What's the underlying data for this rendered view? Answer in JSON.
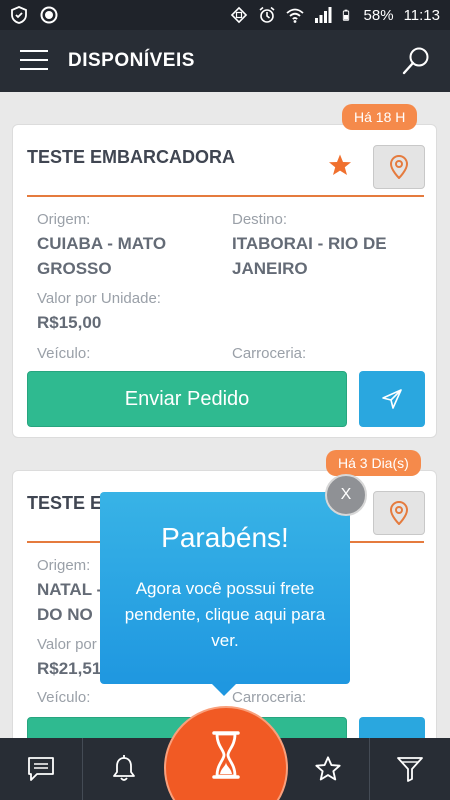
{
  "status_bar": {
    "battery": "58%",
    "time": "11:13",
    "icons": [
      "shield-icon",
      "record-icon",
      "rotate-icon",
      "alarm-icon",
      "wifi-icon",
      "signal-icon",
      "battery-icon"
    ]
  },
  "header": {
    "title": "DISPONÍVEIS",
    "icons": [
      "menu-icon",
      "search-icon"
    ]
  },
  "cards": [
    {
      "age": "Há 18 H",
      "company": "TESTE EMBARCADORA",
      "origin_label": "Origem:",
      "origin_line1": "CUIABA - MATO",
      "origin_line2": "GROSSO",
      "dest_label": "Destino:",
      "dest_line1": "ITABORAI - RIO DE",
      "dest_line2": "JANEIRO",
      "price_label": "Valor por Unidade:",
      "price": "R$15,00",
      "vehicle_label": "Veículo:",
      "body_label": "Carroceria:",
      "send_label": "Enviar Pedido"
    },
    {
      "age": "Há 3 Dia(s)",
      "company": "TESTE EM",
      "origin_label": "Origem:",
      "origin_line1": "NATAL -",
      "origin_line2": "DO NO",
      "price_label": "Valor por",
      "price": "R$21,51",
      "vehicle_label": "Veículo:",
      "body_label": "Carroceria:"
    }
  ],
  "popup": {
    "title": "Parabéns!",
    "body": "Agora você possui frete pendente, clique aqui para ver.",
    "close": "X"
  },
  "bottom_nav": {
    "icons": [
      "chat-icon",
      "bell-icon",
      "hourglass-icon",
      "star-icon",
      "filter-icon"
    ]
  },
  "colors": {
    "appbar": "#282d35",
    "accent_orange": "#f58a4b",
    "divider": "#e57b3e",
    "green": "#2fba90",
    "blue": "#2aa7df",
    "fab": "#f15a24"
  }
}
